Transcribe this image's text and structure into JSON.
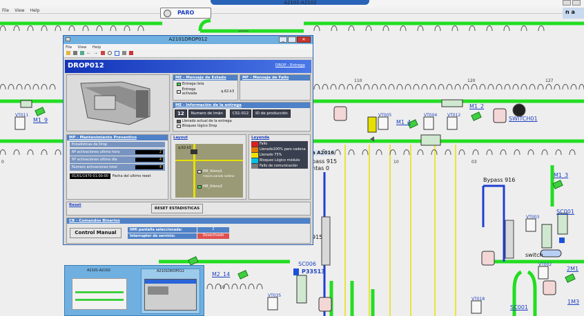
{
  "app": {
    "title": "A2101-A2102",
    "menu": [
      "File",
      "View",
      "Help"
    ],
    "paro": "PARO"
  },
  "schema": {
    "labels": {
      "m1_9": "M1_9",
      "m1_4": "M1_4",
      "m1_2": "M1_2",
      "m1_3": "M1_3",
      "m2_14": "M2_14",
      "switch01": "SWITCH01",
      "sc001": "SC001",
      "sc006": "SC006",
      "sc001b": "SC001",
      "p33513": "P33513",
      "bypass916": "Bypass 916",
      "bypass915": "pass 915",
      "a2016": "a A2016",
      "ntas0": "ntas 0",
      "num915": "915",
      "switch": "switch",
      "m2_1": "2M1",
      "m1_3b": "1M3",
      "ga": "n a"
    },
    "vt": [
      "VT011",
      "VT005",
      "VT004",
      "VT012",
      "VT003",
      "VT002",
      "VT035",
      "VT018"
    ],
    "nums": [
      "110",
      "120",
      "127",
      "10",
      "03",
      "0",
      "10"
    ]
  },
  "taskbar": {
    "thumb1": "A2101-A2102",
    "thumb2": "A2101DROP012"
  },
  "dialog": {
    "title": "A2101DROP012",
    "menu": [
      "File",
      "View",
      "Help"
    ],
    "header": "DROP012",
    "header_link": "DROP - Entrega",
    "estado": {
      "title": "ME - Mensaje de Estado",
      "items": [
        "Entrega lista",
        "Entrega activada"
      ],
      "value": "q.62.k3"
    },
    "fallo": {
      "title": "MF - Mensaje de Fallo"
    },
    "entrega": {
      "title": "ME - Información de la entrega",
      "num": "12",
      "num_label": "Numero de Imán",
      "code": "CS1-012",
      "id_label": "ID de producción",
      "items": [
        "Llenado actual de la entrega",
        "Bloqueo lógico Drop"
      ]
    },
    "mp": {
      "title": "MP - Mantenimiento Preventivo",
      "subtitle": "Estadísticas de Drop",
      "rows": [
        {
          "label": "Nº activaciones ultima hora",
          "value": "2"
        },
        {
          "label": "Nº activaciones ultimo dia",
          "value": "4"
        },
        {
          "label": "Numero activaciones total",
          "value": "4"
        }
      ],
      "date": "01/01/1970 01:00:00",
      "date_label": "Fecha del ultimo reset"
    },
    "layout": {
      "title": "Layout",
      "label_top": "q.62.k3",
      "item1": "M8_Ikleno1",
      "item1_sub": "mejora parada cadena",
      "item2": "M8_Ikleno2"
    },
    "legend": {
      "title": "Leyenda",
      "items": [
        {
          "label": "Fallo",
          "color": "#d92020"
        },
        {
          "label": "Llenado100% paro cadena",
          "color": "#e07a00"
        },
        {
          "label": "Llenado 75%",
          "color": "#f0e000"
        },
        {
          "label": "Bloqueo Lógico módulo",
          "color": "#00c0e0"
        },
        {
          "label": "Fallo de comunicación",
          "color": "#7a7a7a"
        }
      ]
    },
    "reset": {
      "title": "Reset",
      "button": "RESET ESTADISTICAS"
    },
    "cb": {
      "title": "CB - Comandos Binarios",
      "button": "Control Manual",
      "row1_label": "HMI pantalla seleccionada:",
      "row1_value": "2",
      "row2_label": "Interruptor de servicio:",
      "row2_value": "Desactivado"
    }
  }
}
